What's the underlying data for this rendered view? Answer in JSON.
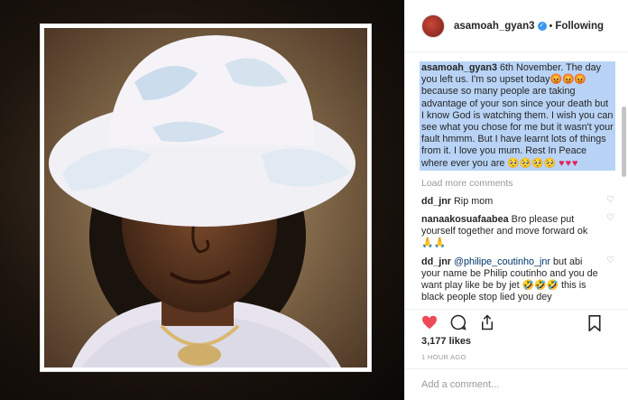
{
  "post": {
    "username": "asamoah_gyan3",
    "follow_state": "Following",
    "dot": "•",
    "caption": {
      "username": "asamoah_gyan3",
      "text": " 6th November. The day you left us. I'm so upset today😡😡😡 because so many people are taking advantage of your son since your death but I know God is watching them. I wish you can see what you chose for me but it wasn't your fault hmmm. But I have learnt lots of things from it. I love you mum. Rest In Peace where ever you are 🥺🥺🥺🥺",
      "hearts": "♥♥♥"
    },
    "load_more": "Load more comments",
    "comments": [
      {
        "username": "dd_jnr",
        "text": " Rip mom"
      },
      {
        "username": "nanaakosuafaabea",
        "text": " Bro please put yourself together and move forward ok 🙏🙏"
      },
      {
        "username": "dd_jnr",
        "mention": " @philipe_coutinho_jnr",
        "text": " but abi your name be Philip coutinho and you de want play like be by jet 🤣🤣🤣 this is black people stop lied you dey"
      }
    ],
    "likes": "3,177 likes",
    "time": "1 HOUR AGO",
    "add_comment_placeholder": "Add a comment..."
  },
  "colors": {
    "like_red": "#ed4956",
    "verified_blue": "#3897f0",
    "caption_highlight": "#b8d3f5"
  }
}
